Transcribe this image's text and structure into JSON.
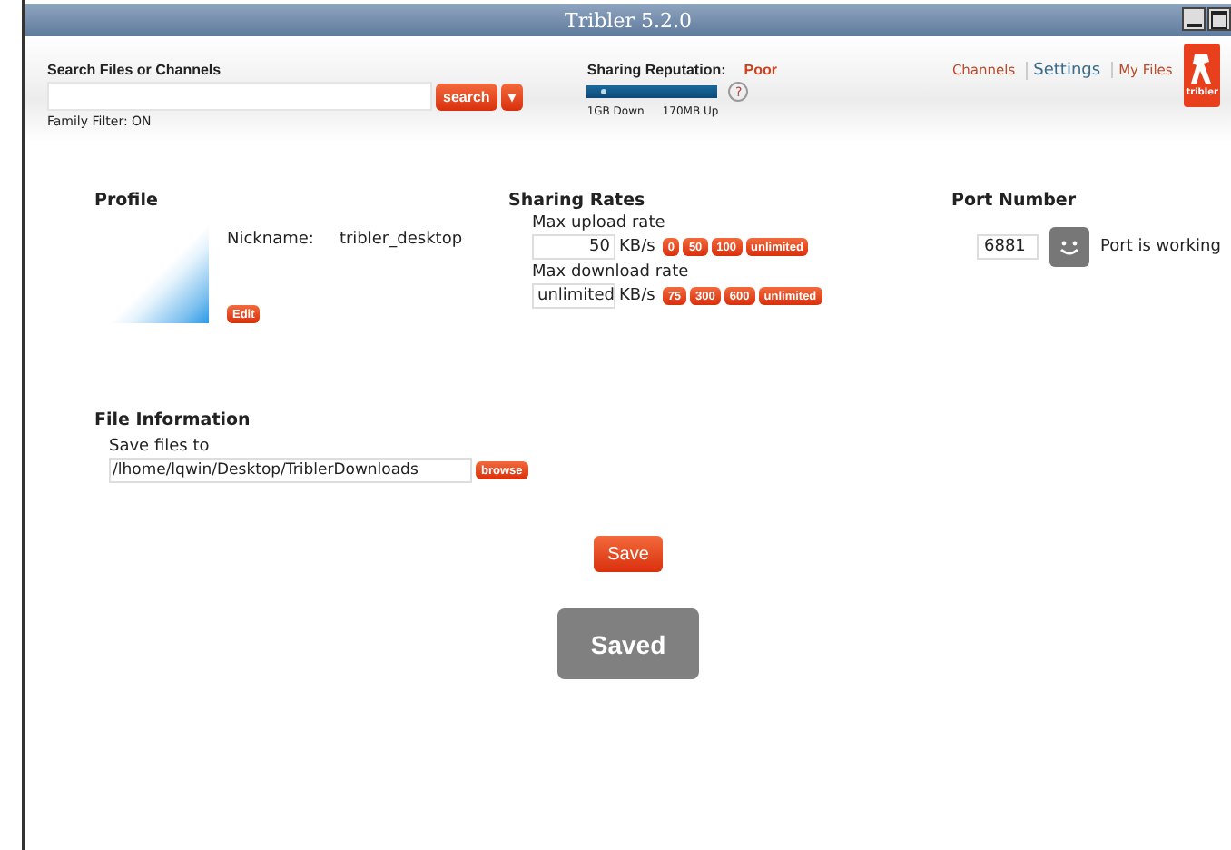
{
  "window": {
    "title": "Tribler 5.2.0"
  },
  "search": {
    "label": "Search Files or Channels",
    "button": "search",
    "dropdown": "▾",
    "family_filter": "Family Filter: ON"
  },
  "reputation": {
    "label": "Sharing Reputation:",
    "value": "Poor",
    "level": 0.1,
    "help": "?",
    "down": "1GB Down",
    "up": "170MB Up"
  },
  "nav": [
    {
      "label": "Channels",
      "selected": false
    },
    {
      "label": "Settings",
      "selected": true
    },
    {
      "label": "My Files",
      "selected": false
    }
  ],
  "logo": {
    "text": "tribler"
  },
  "profile": {
    "title": "Profile",
    "nickname_label": "Nickname:",
    "nickname": "tribler_desktop",
    "edit": "Edit"
  },
  "sharing_rates": {
    "title": "Sharing Rates",
    "rates": [
      {
        "label": "Max upload rate",
        "value": "50",
        "unit": "KB/s",
        "presets": [
          "0",
          "50",
          "100",
          "unlimited"
        ]
      },
      {
        "label": "Max download rate",
        "value": "unlimited",
        "unit": "KB/s",
        "presets": [
          "75",
          "300",
          "600",
          "unlimited"
        ]
      }
    ]
  },
  "port": {
    "title": "Port Number",
    "value": "6881",
    "status": "Port is working"
  },
  "file_information": {
    "title": "File Information",
    "label": "Save files to",
    "path": "/lhome/lqwin/Desktop/TriblerDownloads",
    "browse": "browse"
  },
  "save": "Save",
  "saved": "Saved"
}
